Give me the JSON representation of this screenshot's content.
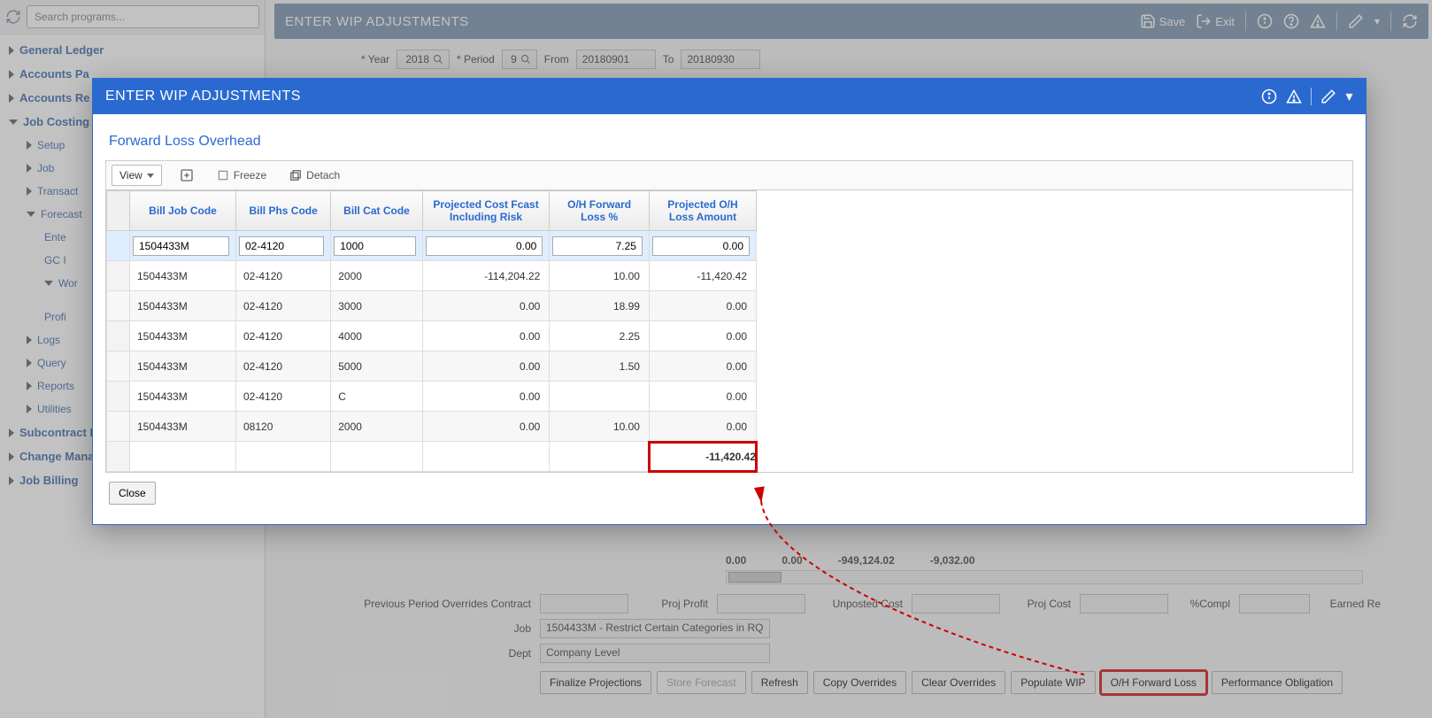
{
  "search_placeholder": "Search programs...",
  "sidebar": {
    "items": [
      {
        "label": "General Ledger",
        "level": 0,
        "caret": "closed"
      },
      {
        "label": "Accounts Pa",
        "level": 0,
        "caret": "closed"
      },
      {
        "label": "Accounts Re",
        "level": 0,
        "caret": "closed"
      },
      {
        "label": "Job Costing",
        "level": 0,
        "caret": "open"
      },
      {
        "label": "Setup",
        "level": 1,
        "caret": "closed"
      },
      {
        "label": "Job",
        "level": 1,
        "caret": "closed"
      },
      {
        "label": "Transact",
        "level": 1,
        "caret": "closed"
      },
      {
        "label": "Forecast",
        "level": 1,
        "caret": "open"
      },
      {
        "label": "Ente",
        "level": 2,
        "caret": "none"
      },
      {
        "label": "GC I",
        "level": 2,
        "caret": "none"
      },
      {
        "label": "Wor",
        "level": 2,
        "caret": "open"
      },
      {
        "label": "",
        "level": 3,
        "caret": "none"
      },
      {
        "label": "Profi",
        "level": 2,
        "caret": "none"
      },
      {
        "label": "Logs",
        "level": 1,
        "caret": "closed"
      },
      {
        "label": "Query",
        "level": 1,
        "caret": "closed"
      },
      {
        "label": "Reports",
        "level": 1,
        "caret": "closed"
      },
      {
        "label": "Utilities",
        "level": 1,
        "caret": "closed"
      },
      {
        "label": "Subcontract Management",
        "level": 0,
        "caret": "closed"
      },
      {
        "label": "Change Management",
        "level": 0,
        "caret": "closed"
      },
      {
        "label": "Job Billing",
        "level": 0,
        "caret": "closed"
      }
    ]
  },
  "main_title": "ENTER WIP ADJUSTMENTS",
  "hdr_save": "Save",
  "hdr_exit": "Exit",
  "filter": {
    "year_lbl": "Year",
    "year_val": "2018",
    "period_lbl": "Period",
    "period_val": "9",
    "from_lbl": "From",
    "from_val": "20180901",
    "to_lbl": "To",
    "to_val": "20180930"
  },
  "modal": {
    "title": "ENTER WIP ADJUSTMENTS",
    "section": "Forward Loss Overhead",
    "view_label": "View",
    "freeze_label": "Freeze",
    "detach_label": "Detach",
    "close_label": "Close",
    "columns": [
      "Bill Job Code",
      "Bill Phs Code",
      "Bill Cat Code",
      "Projected Cost Fcast Including Risk",
      "O/H Forward Loss %",
      "Projected O/H Loss Amount"
    ],
    "rows": [
      {
        "job": "1504433M",
        "phs": "02-4120",
        "cat": "1000",
        "proj": "0.00",
        "pct": "7.25",
        "amt": "0.00",
        "editable": true
      },
      {
        "job": "1504433M",
        "phs": "02-4120",
        "cat": "2000",
        "proj": "-114,204.22",
        "pct": "10.00",
        "amt": "-11,420.42"
      },
      {
        "job": "1504433M",
        "phs": "02-4120",
        "cat": "3000",
        "proj": "0.00",
        "pct": "18.99",
        "amt": "0.00"
      },
      {
        "job": "1504433M",
        "phs": "02-4120",
        "cat": "4000",
        "proj": "0.00",
        "pct": "2.25",
        "amt": "0.00"
      },
      {
        "job": "1504433M",
        "phs": "02-4120",
        "cat": "5000",
        "proj": "0.00",
        "pct": "1.50",
        "amt": "0.00"
      },
      {
        "job": "1504433M",
        "phs": "02-4120",
        "cat": "C",
        "proj": "0.00",
        "pct": "",
        "amt": "0.00"
      },
      {
        "job": "1504433M",
        "phs": "08120",
        "cat": "2000",
        "proj": "0.00",
        "pct": "10.00",
        "amt": "0.00"
      }
    ],
    "total_amt": "-11,420.42"
  },
  "summary_strip": {
    "v1": "0.00",
    "v2": "0.00",
    "v3": "-949,124.02",
    "v4": "-9,032.00"
  },
  "form": {
    "prev_override_lbl": "Previous Period Overrides Contract",
    "proj_profit_lbl": "Proj Profit",
    "unposted_cost_lbl": "Unposted Cost",
    "proj_cost_lbl": "Proj Cost",
    "pct_compl_lbl": "%Compl",
    "earned_lbl": "Earned Re",
    "job_lbl": "Job",
    "job_val": "1504433M - Restrict Certain Categories in RQ",
    "dept_lbl": "Dept",
    "dept_val": "Company Level"
  },
  "buttons": {
    "finalize": "Finalize Projections",
    "store": "Store Forecast",
    "refresh": "Refresh",
    "copy": "Copy Overrides",
    "clear": "Clear Overrides",
    "populate": "Populate WIP",
    "ohloss": "O/H Forward Loss",
    "perf": "Performance Obligation"
  }
}
